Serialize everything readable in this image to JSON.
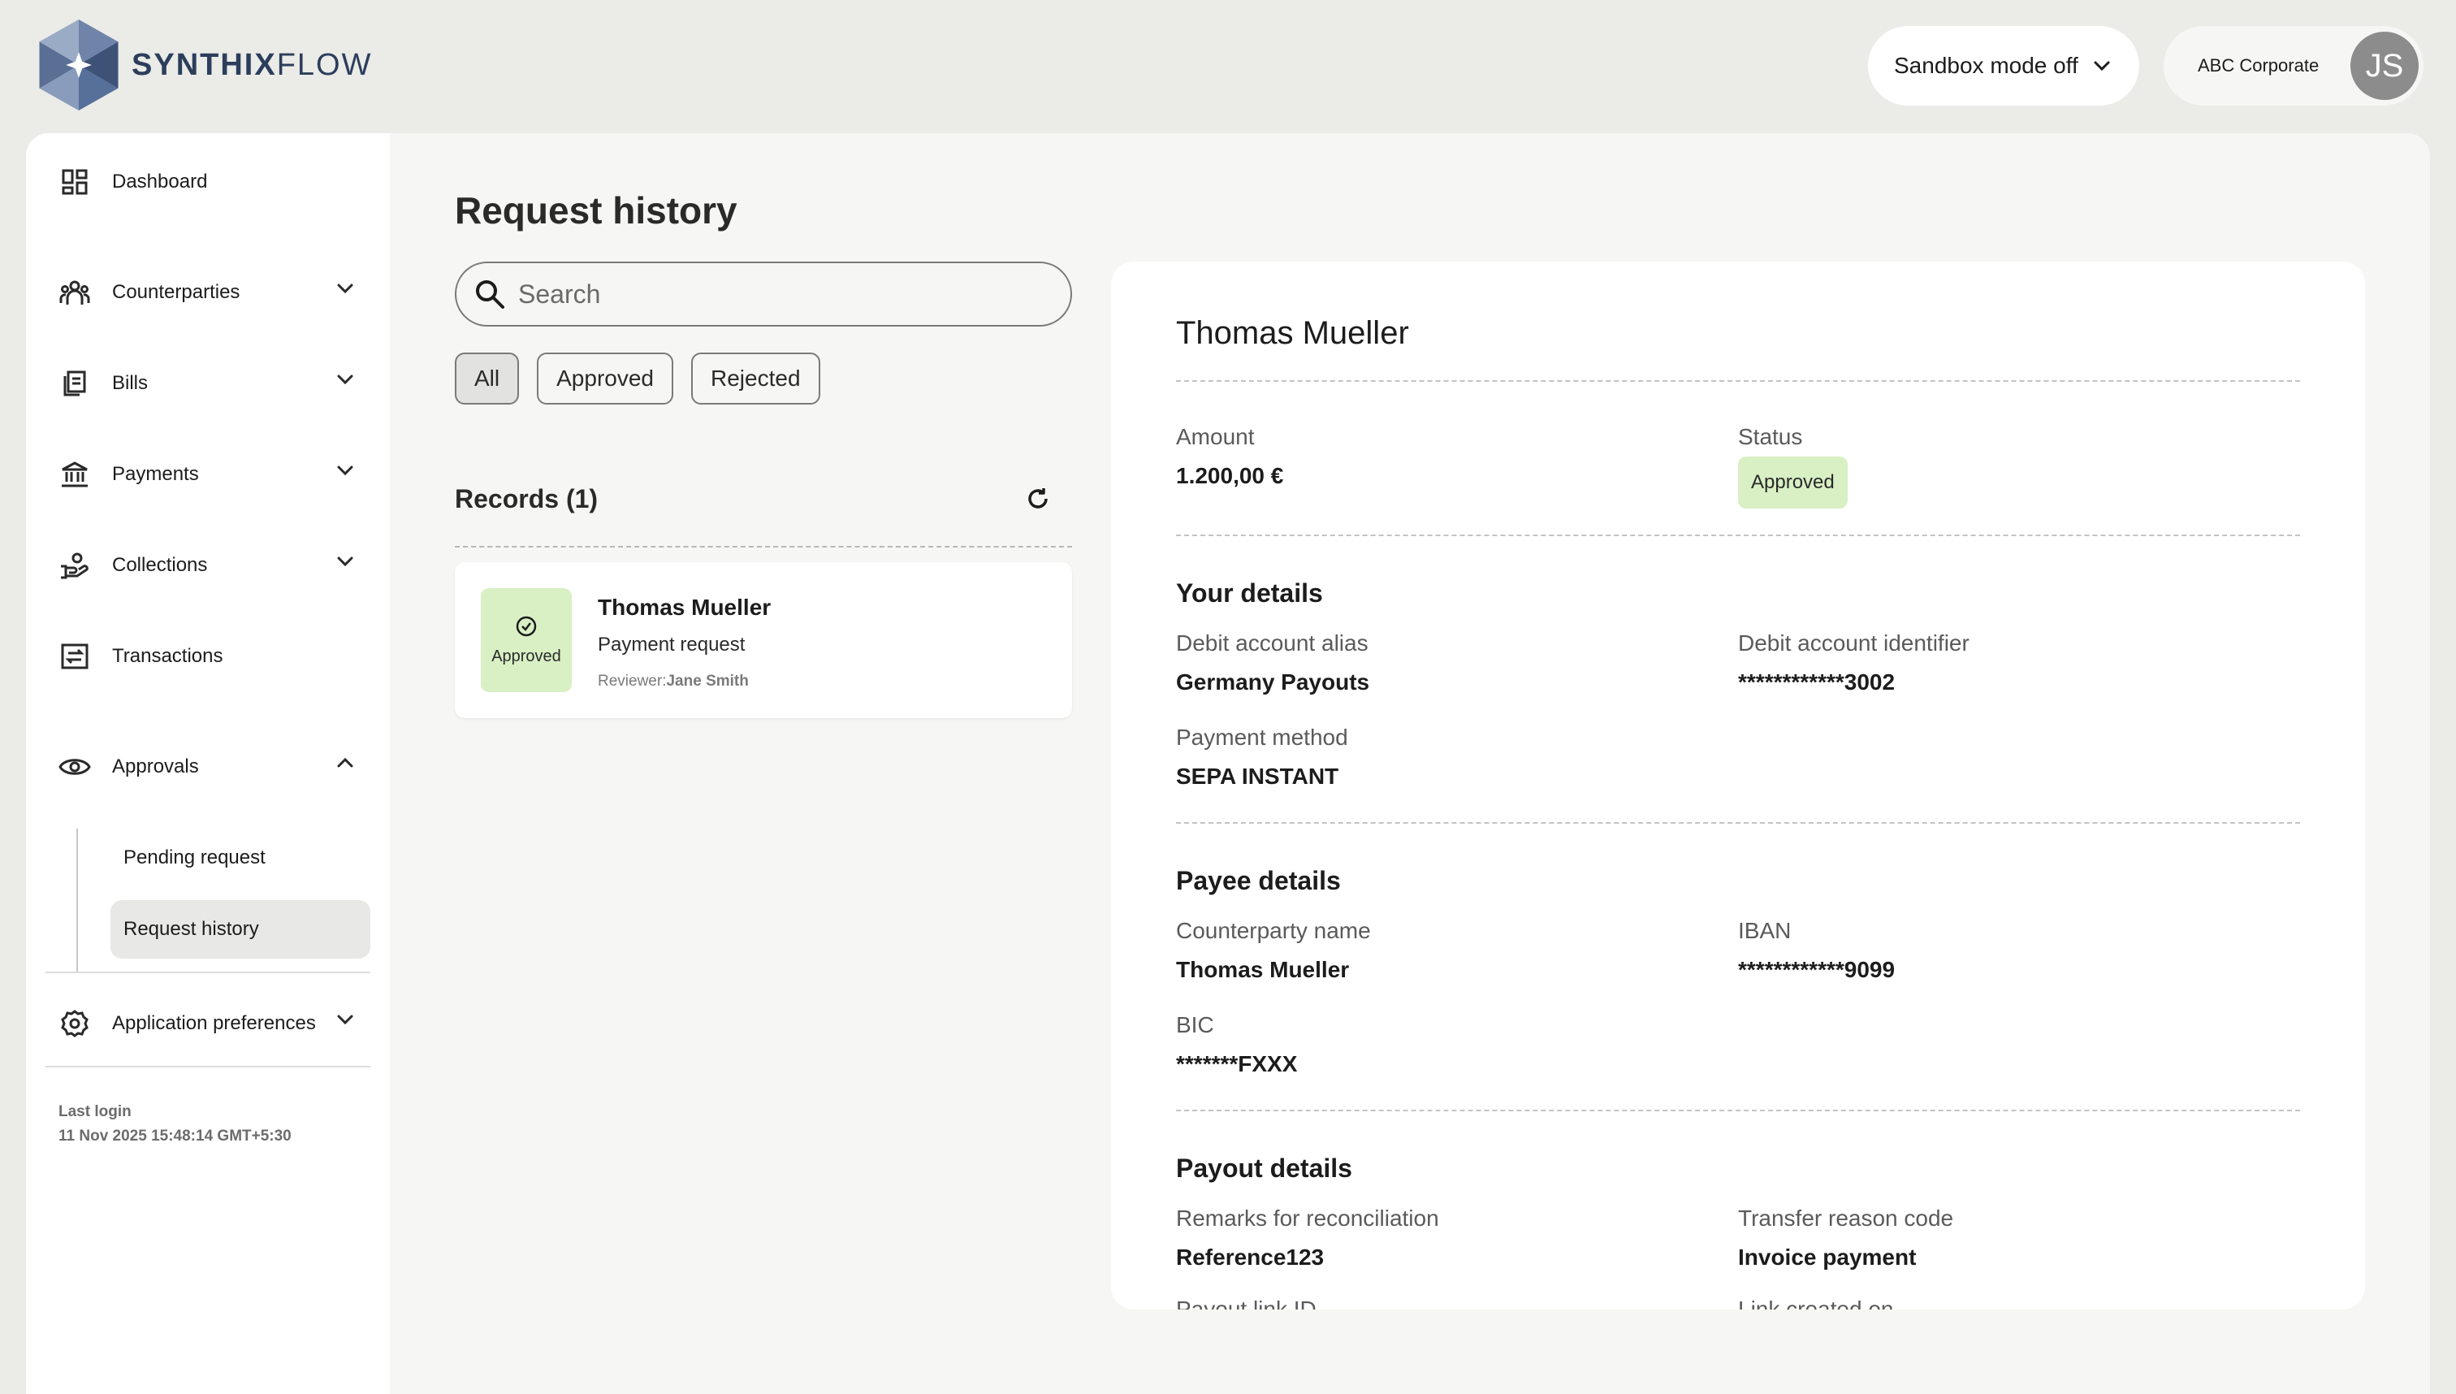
{
  "brand": {
    "name_bold": "SYNTHIX",
    "name_light": "FLOW"
  },
  "header": {
    "sandbox_label": "Sandbox mode off",
    "account_name": "ABC Corporate",
    "avatar_initials": "JS"
  },
  "sidebar": {
    "items": [
      {
        "label": "Dashboard",
        "icon": "dashboard-icon"
      },
      {
        "label": "Counterparties",
        "icon": "people-icon"
      },
      {
        "label": "Bills",
        "icon": "bills-icon"
      },
      {
        "label": "Payments",
        "icon": "bank-icon"
      },
      {
        "label": "Collections",
        "icon": "collections-icon"
      },
      {
        "label": "Transactions",
        "icon": "transactions-icon"
      },
      {
        "label": "Approvals",
        "icon": "eye-icon"
      }
    ],
    "approvals_sub": [
      {
        "label": "Pending request"
      },
      {
        "label": "Request history"
      }
    ],
    "preferences_label": "Application preferences",
    "last_login_label": "Last login",
    "last_login_value": "11 Nov 2025 15:48:14 GMT+5:30"
  },
  "main": {
    "title": "Request history",
    "search_placeholder": "Search",
    "filters": [
      "All",
      "Approved",
      "Rejected"
    ],
    "records_title": "Records (1)",
    "records": [
      {
        "status": "Approved",
        "name": "Thomas Mueller",
        "type": "Payment request",
        "reviewer_label": "Reviewer:",
        "reviewer_name": "Jane Smith"
      }
    ]
  },
  "detail": {
    "title": "Thomas Mueller",
    "amount_label": "Amount",
    "amount_value": "1.200,00 €",
    "status_label": "Status",
    "status_value": "Approved",
    "your_details": {
      "heading": "Your details",
      "debit_alias_label": "Debit account alias",
      "debit_alias_value": "Germany Payouts",
      "debit_id_label": "Debit account identifier",
      "debit_id_value": "************3002",
      "payment_method_label": "Payment method",
      "payment_method_value": "SEPA INSTANT"
    },
    "payee_details": {
      "heading": "Payee details",
      "counterparty_label": "Counterparty name",
      "counterparty_value": "Thomas Mueller",
      "iban_label": "IBAN",
      "iban_value": "************9099",
      "bic_label": "BIC",
      "bic_value": "*******FXXX"
    },
    "payout_details": {
      "heading": "Payout details",
      "remarks_label": "Remarks for reconciliation",
      "remarks_value": "Reference123",
      "reason_label": "Transfer reason code",
      "reason_value": "Invoice payment",
      "payout_link_label": "Payout link ID",
      "link_created_label": "Link created on"
    }
  },
  "colors": {
    "brand_navy": "#2c3e5c",
    "approved_bg": "#d8f0c4",
    "page_bg": "#ebebe7"
  }
}
